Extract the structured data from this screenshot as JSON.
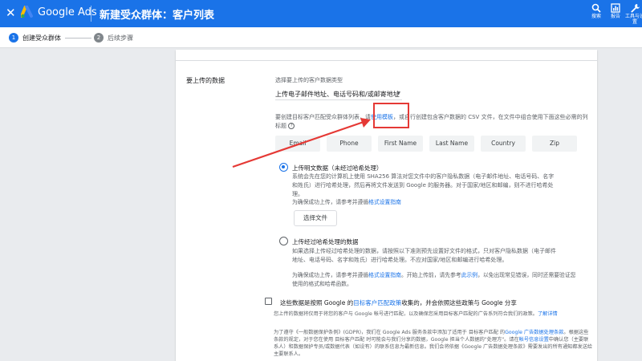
{
  "header": {
    "close_glyph": "✕",
    "brand": "Google Ads",
    "page_title": "新建受众群体：客户列表",
    "tools": [
      {
        "icon": "search-icon",
        "label": "搜索"
      },
      {
        "icon": "report-icon",
        "label": "报告"
      },
      {
        "icon": "wrench-icon",
        "label": "工具与设置"
      }
    ]
  },
  "stepper": {
    "steps": [
      {
        "num": "1",
        "label": "创建受众群体",
        "active": true
      },
      {
        "num": "2",
        "label": "后续步骤",
        "active": false
      }
    ]
  },
  "upload": {
    "section_label": "要上传的数据",
    "hint": "选择要上传的客户数据类型",
    "dropdown_value": "上传电子邮件地址、电话号码和/或邮寄地址",
    "desc_before": "要创建目标客户匹配受众群体列表，请",
    "desc_link": "使用模板",
    "desc_after": "，或自行创建包含客户数据的 CSV 文件，在文件中组合使用下面这些必需的列标题",
    "help_glyph": "?",
    "columns": [
      "Email",
      "Phone",
      "First Name",
      "Last Name",
      "Country",
      "Zip"
    ]
  },
  "option_plain": {
    "title": "上传明文数据（未经过哈希处理）",
    "body": "系统会先在您的计算机上使用 SHA256 算法对您文件中的客户隐私数据（电子邮件地址、电话号码、名字和姓氏）进行哈希处理，然后再将文件发送到 Google 的服务器。对于国家/地区和邮编，则不进行哈希处理。",
    "note_before": "为确保成功上传，请参考并遵循",
    "note_link": "格式设置指南",
    "button": "选择文件"
  },
  "option_hashed": {
    "title": "上传经过哈希处理的数据",
    "body": "如果选择上传经过哈希处理的数据，请按照以下准则预先设置好文件的格式，只对客户隐私数据（电子邮件地址、电话号码、名字和姓氏）进行哈希处理。不应对国家/地区和邮编进行哈希处理。",
    "note_before": "为确保成功上传，请参考并遵循",
    "note_link": "格式设置指南",
    "note_mid": "。开始上传前，请先参考",
    "note_link2": "此示例",
    "note_after": "，以免出现常见错误，同时还需要验证您使用的格式和哈希函数。"
  },
  "consent": {
    "label_before": "这些数据是按照 Google 的",
    "label_link": "目标客户匹配政策",
    "label_after": "收集的，并会依照这些政策与 Google 分享"
  },
  "fine_print": {
    "p1_before": "您上传的数据将仅用于将您的客户与 Google 帐号进行匹配，以及确保您采用目标客户匹配的广告系列符合我们的政策。",
    "p1_link": "了解详情",
    "p2_before": "为了遵守《一般数据保护条例》(GDPR)，我们在 Google Ads 服务条款中添加了适用于 目标客户匹配 的",
    "p2_link1": "Google 广告数据处理条款",
    "p2_mid": "。根据这些条款的规定，对于您在使用 目标客户匹配 时可能会与我们分享的数据，Google 担当个人数据的\"处理方\"。请在",
    "p2_link2": "帐号信息设置",
    "p2_after": "中确认您（主要联系人）和数据保护专员/或数据代表（如设有）的联系信息为最新信息。我们会将依据《Google 广告数据处理条款》需要发出的所有通知都发送给主要联系人。"
  },
  "colors": {
    "accent": "#1a73e8",
    "annotation": "#e53935"
  }
}
